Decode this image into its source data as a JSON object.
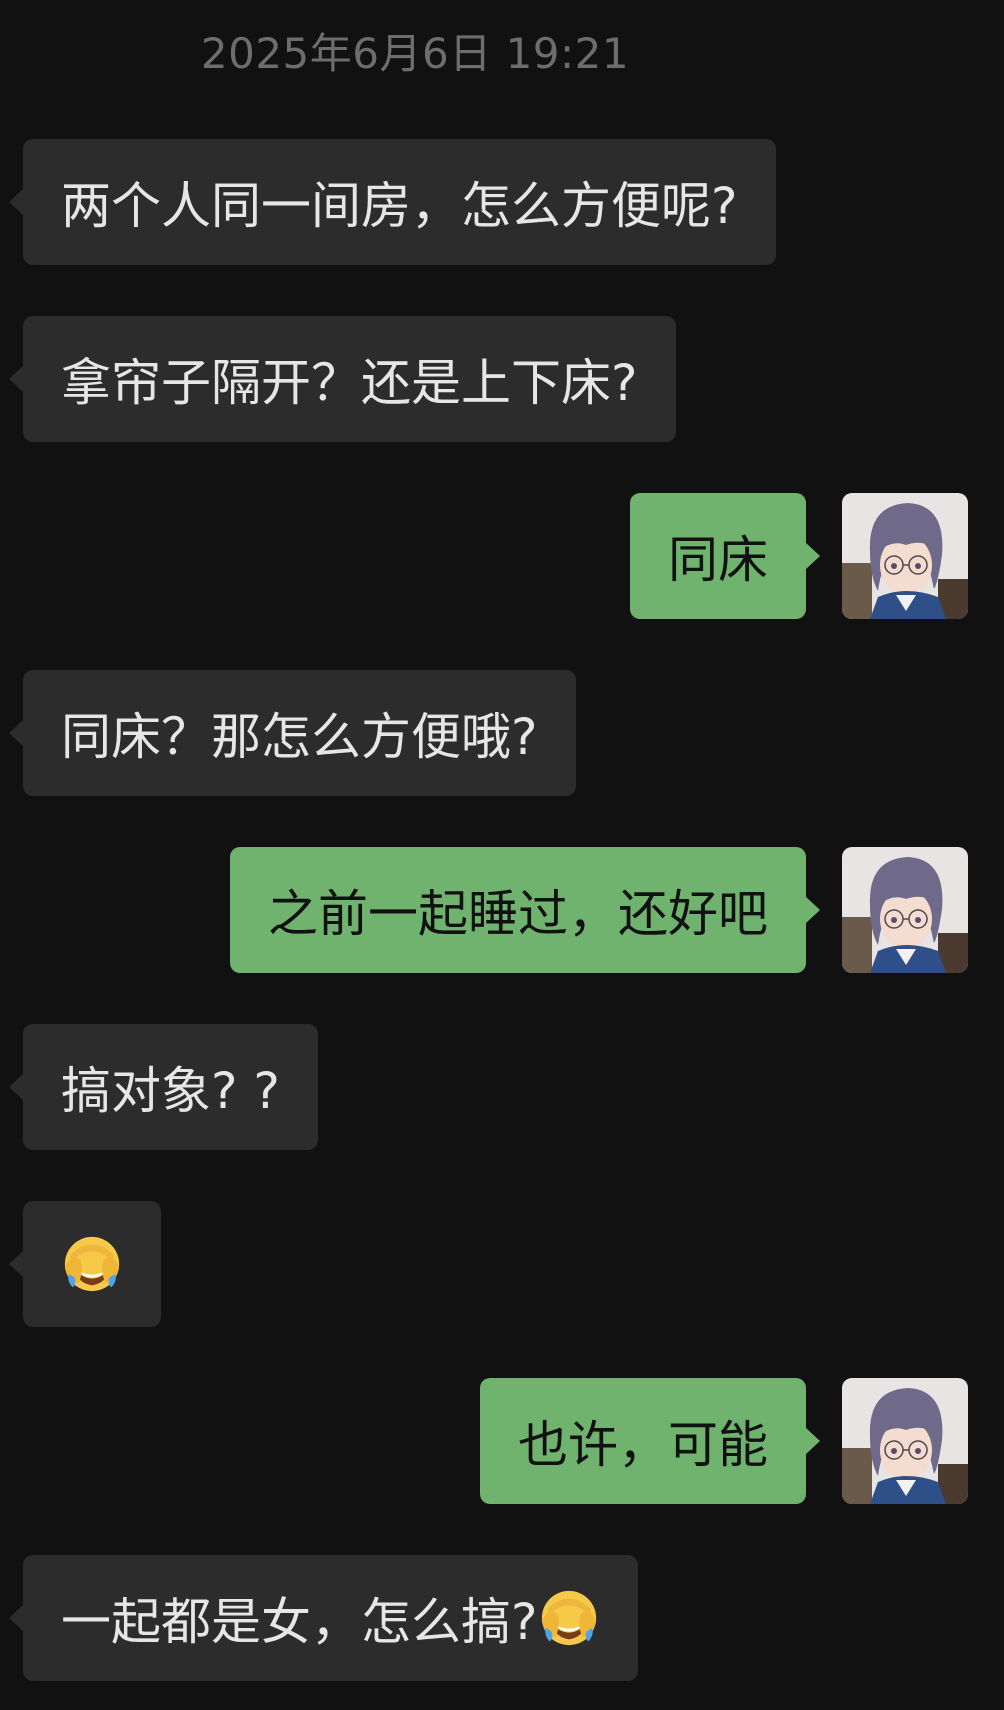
{
  "timestamp": "2025年6月6日 19:21",
  "messages": [
    {
      "side": "in",
      "text": "两个人同一间房，怎么方便呢?"
    },
    {
      "side": "in",
      "text": "拿帘子隔开？还是上下床?"
    },
    {
      "side": "out",
      "text": "同床"
    },
    {
      "side": "in",
      "text": "同床？那怎么方便哦?"
    },
    {
      "side": "out",
      "text": "之前一起睡过，还好吧"
    },
    {
      "side": "in",
      "text": "搞对象? ?"
    },
    {
      "side": "in",
      "text": "",
      "emoji": "face-palm-tears-emoji"
    },
    {
      "side": "out",
      "text": "也许，可能"
    },
    {
      "side": "in",
      "text": "一起都是女，怎么搞?",
      "emoji": "face-palm-tears-emoji"
    }
  ],
  "avatar": {
    "icon": "anime-girl-glasses-avatar"
  },
  "colors": {
    "background": "#111111",
    "incoming_bubble": "#2c2c2c",
    "outgoing_bubble": "#6fb36f",
    "timestamp_text": "#6d6d6d"
  }
}
